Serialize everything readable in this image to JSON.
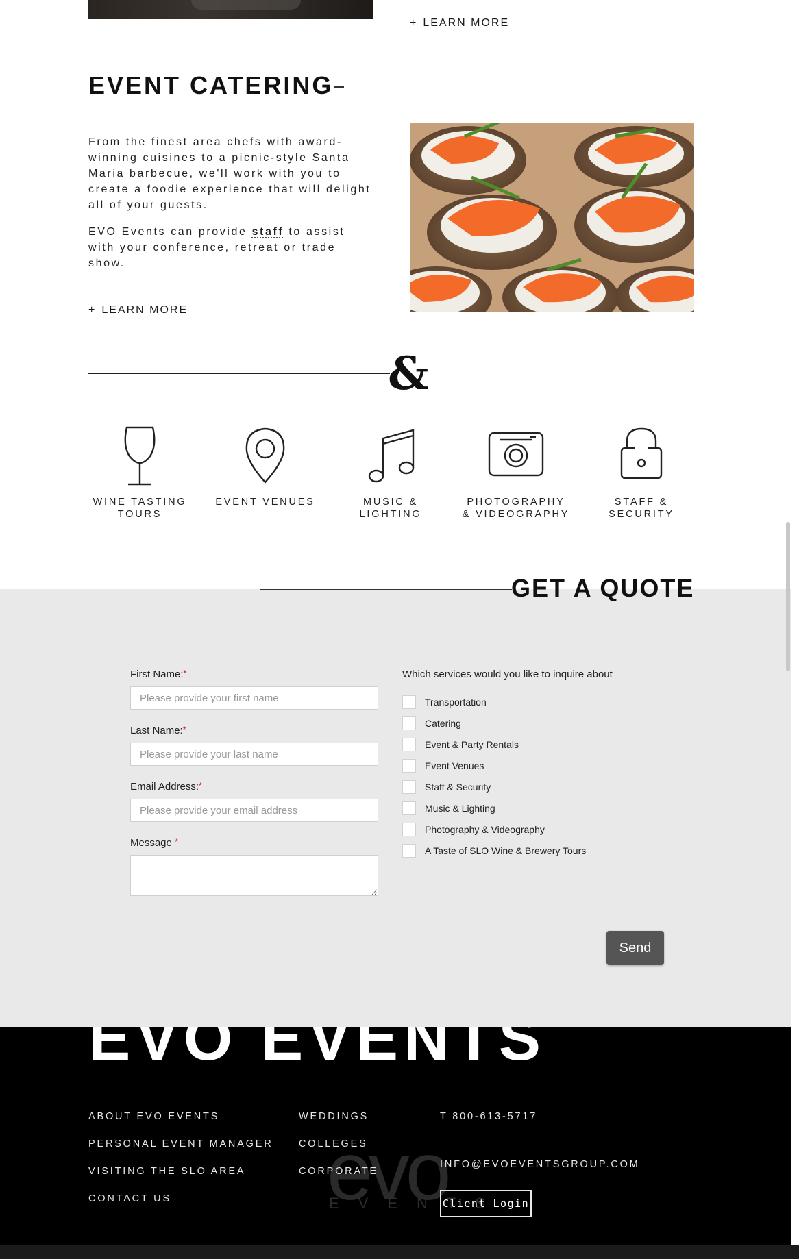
{
  "prev_section": {
    "learn_more": "LEARN MORE",
    "plus": "+"
  },
  "catering": {
    "title": "EVENT CATERING",
    "p1": "From the finest area chefs with award-winning cuisines to a picnic-style Santa Maria barbecue, we'll work with you to create a foodie experience that will delight all of your guests.",
    "p2_before": "EVO Events can provide ",
    "p2_link": "staff",
    "p2_after": " to assist with your conference, retreat or trade show.",
    "learn_more": "LEARN MORE",
    "plus": "+"
  },
  "ampersand": "&",
  "services": [
    {
      "icon": "wine-glass-icon",
      "label": "WINE TASTING TOURS"
    },
    {
      "icon": "map-pin-icon",
      "label": "EVENT VENUES"
    },
    {
      "icon": "music-note-icon",
      "label": "MUSIC & LIGHTING"
    },
    {
      "icon": "camera-icon",
      "label": "PHOTOGRAPHY & VIDEOGRAPHY"
    },
    {
      "icon": "lock-icon",
      "label": "STAFF & SECURITY"
    }
  ],
  "quote": {
    "title": "GET A QUOTE",
    "first_name_label": "First Name:",
    "first_name_placeholder": "Please provide your first name",
    "last_name_label": "Last Name:",
    "last_name_placeholder": "Please provide your last name",
    "email_label": "Email Address:",
    "email_placeholder": "Please provide your email address",
    "message_label": "Message",
    "required_mark": "*",
    "services_label": "Which services would you like to inquire about",
    "options": [
      "Transportation",
      "Catering",
      "Event & Party Rentals",
      "Event Venues",
      "Staff & Security",
      "Music & Lighting",
      "Photography & Videography",
      "A Taste of SLO Wine & Brewery Tours"
    ],
    "send_label": "Send"
  },
  "footer": {
    "brand": "EVO EVENTS",
    "col1": [
      "ABOUT EVO EVENTS",
      "PERSONAL EVENT MANAGER",
      "VISITING THE SLO AREA",
      "CONTACT US"
    ],
    "col2": [
      "WEDDINGS",
      "COLLEGES",
      "CORPORATE"
    ],
    "phone": "T 800-613-5717",
    "email": "INFO@EVOEVENTSGROUP.COM",
    "client_login": "Client Login",
    "logo_word": "evo",
    "logo_sub": "EVENTS"
  }
}
